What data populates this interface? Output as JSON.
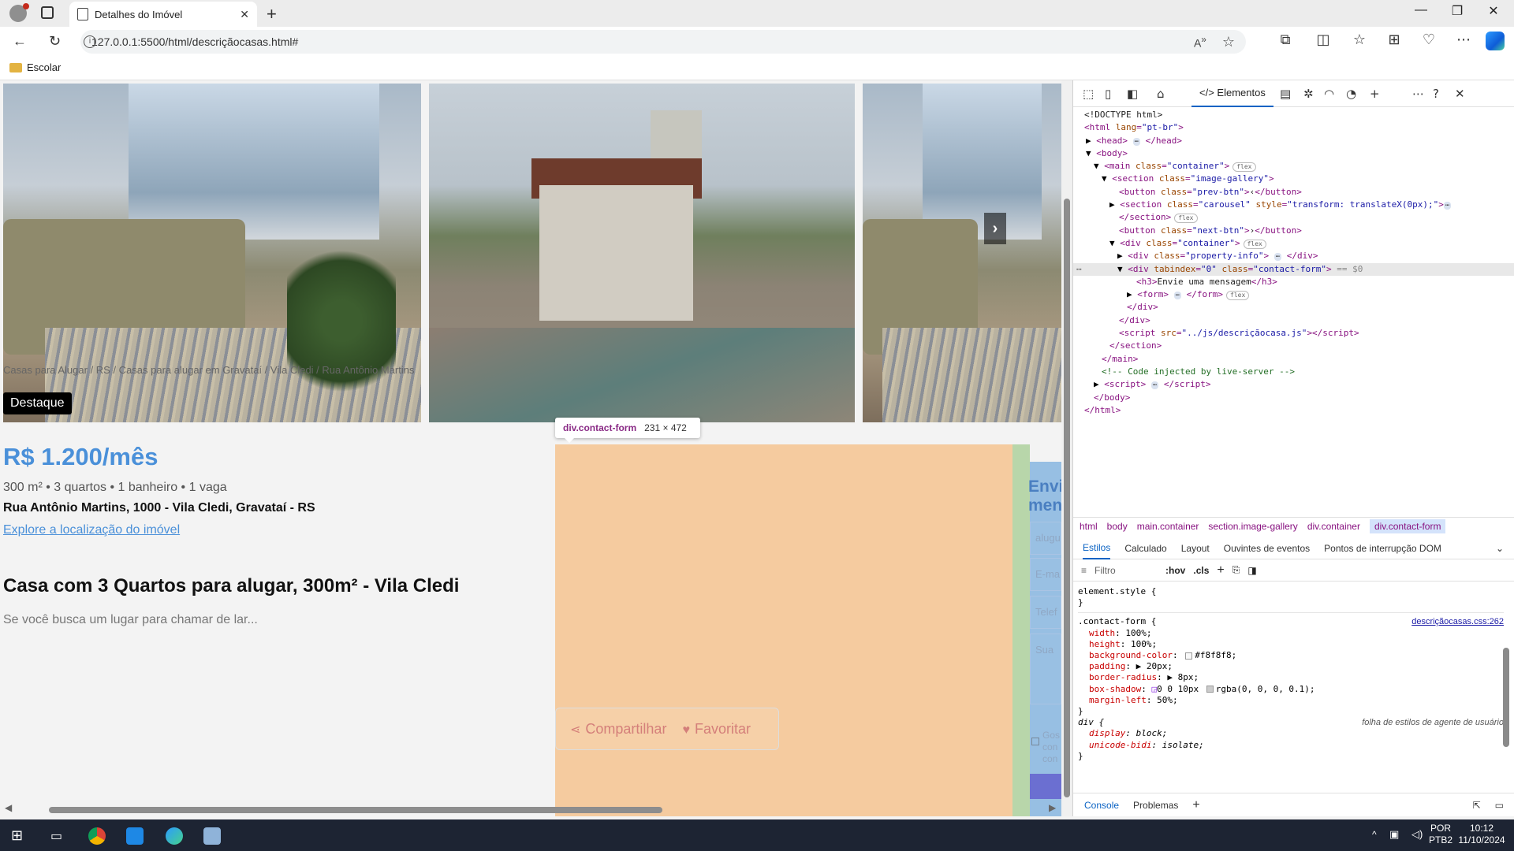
{
  "browser": {
    "tab_title": "Detalhes do Imóvel",
    "url": "127.0.0.1:5500/html/descriçãocasas.html#",
    "favorite": "Escolar"
  },
  "page": {
    "breadcrumb": "Casas para Alugar / RS / Casas para alugar em Gravataí / Vila Cledi / Rua Antônio Martins",
    "badge": "Destaque",
    "price": "R$ 1.200/mês",
    "features": "300 m² • 3 quartos • 1 banheiro • 1 vaga",
    "address": "Rua Antônio Martins, 1000 - Vila Cledi, Gravataí - RS",
    "map_link": "Explore a localização do imóvel",
    "heading": "Casa com 3 Quartos para alugar, 300m² - Vila Cledi",
    "description": "Se você busca um lugar para chamar de lar...",
    "next_btn": "›",
    "share": "Compartilhar",
    "favorite": "Favoritar",
    "form": {
      "title_line1": "Envi",
      "title_line2": "men",
      "field1": "alugu",
      "field2": "E-ma",
      "field3": "Telef",
      "field4": "Sua",
      "check_l1": "Gos",
      "check_l2": "con",
      "check_l3": "con"
    },
    "tooltip": {
      "name": "div.contact-form",
      "size": "231 × 472"
    }
  },
  "devtools": {
    "tab": "Elementos",
    "breadcrumbs": [
      "html",
      "body",
      "main.container",
      "section.image-gallery",
      "div.container",
      "div.contact-form"
    ],
    "subtabs": [
      "Estilos",
      "Calculado",
      "Layout",
      "Ouvintes de eventos",
      "Pontos de interrupção DOM"
    ],
    "filter_placeholder": "Filtro",
    "filter_hov": ":hov",
    "filter_cls": ".cls",
    "source_link": "descriçãocasas.css:262",
    "ua_label": "folha de estilos de agente de usuário",
    "drawer": [
      "Console",
      "Problemas"
    ],
    "dom": {
      "doctype": "<!DOCTYPE html>",
      "html_attr": "lang",
      "html_val": "\"pt-br\"",
      "main_class": "\"container\"",
      "gallery_class": "\"image-gallery\"",
      "prev_class": "\"prev-btn\"",
      "prev_text": "‹",
      "carousel_class": "\"carousel\"",
      "carousel_style": "\"transform: translateX(0px);\"",
      "next_class": "\"next-btn\"",
      "next_text": "›",
      "container_class": "\"container\"",
      "info_class": "\"property-info\"",
      "contact_tabindex": "\"0\"",
      "contact_class": "\"contact-form\"",
      "dollar": "== $0",
      "h3_text": "Envie uma mensagem",
      "script_src": "\"../js/descriçãocasa.js\"",
      "comment": "<!-- Code injected by live-server -->",
      "pill_flex": "flex"
    },
    "styles": {
      "element_style": "element.style {",
      "selector": ".contact-form {",
      "width": "100%;",
      "height": "100%;",
      "bg": "#f8f8f8;",
      "padding": "20px;",
      "radius": "8px;",
      "shadow_a": "0 0 10px",
      "shadow_b": "rgba(0, 0, 0, 0.1);",
      "margin": "50%;",
      "div_sel": "div {",
      "display": "block;",
      "unicode": "isolate;"
    }
  },
  "taskbar": {
    "lang1": "POR",
    "lang2": "PTB2",
    "time": "10:12",
    "date": "11/10/2024"
  }
}
